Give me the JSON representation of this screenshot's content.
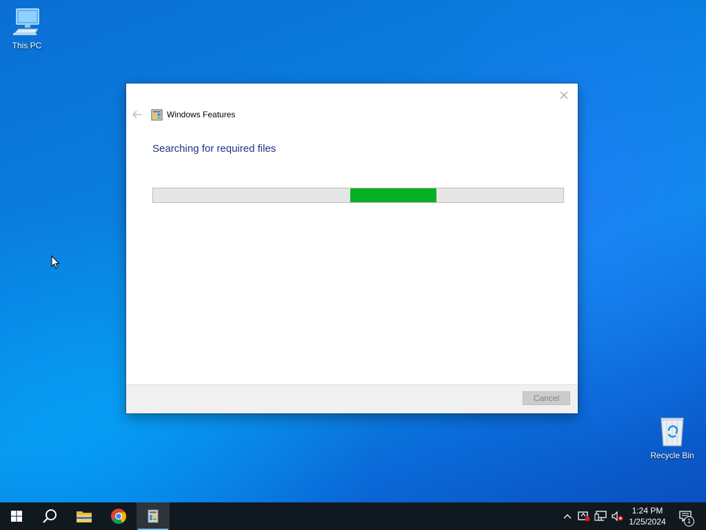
{
  "desktop": {
    "icons": [
      {
        "label": "This PC"
      },
      {
        "label": "Recycle Bin"
      }
    ]
  },
  "dialog": {
    "app_title": "Windows Features",
    "status_heading": "Searching for required files",
    "progress": {
      "mode": "indeterminate",
      "chunk_start_fraction": 0.48,
      "chunk_end_fraction": 0.69,
      "color": "#06b025"
    },
    "cancel_label": "Cancel",
    "cancel_enabled": false
  },
  "taskbar": {
    "apps": [
      {
        "name": "start-button",
        "icon": "windows-logo-icon"
      },
      {
        "name": "search-button",
        "icon": "search-icon"
      },
      {
        "name": "file-explorer",
        "icon": "folder-icon"
      },
      {
        "name": "chrome",
        "icon": "chrome-icon"
      },
      {
        "name": "windows-features",
        "icon": "windows-features-icon",
        "active": true
      }
    ],
    "clock": {
      "time": "1:24 PM",
      "date": "1/25/2024"
    },
    "notification_count": "1"
  },
  "colors": {
    "accent": "#1e3287",
    "progress": "#06b025",
    "taskbar": "#101820"
  }
}
